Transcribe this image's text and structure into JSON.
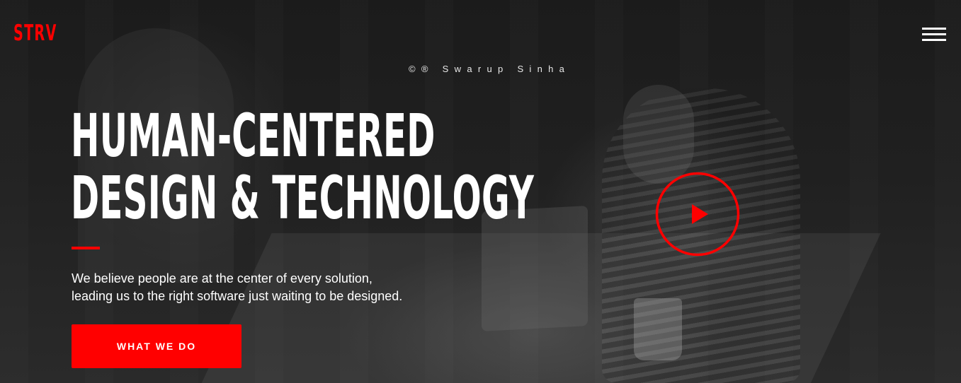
{
  "brand": {
    "logo_text": "STRV",
    "accent_color": "#ff0000"
  },
  "header": {
    "menu_icon": "hamburger-menu-icon"
  },
  "hero": {
    "credit": "©® Swarup Sinha",
    "headline_line1": "HUMAN-CENTERED",
    "headline_line2": "DESIGN & TECHNOLOGY",
    "tagline_line1": "We believe people are at the center of every solution,",
    "tagline_line2": "leading us to the right software just waiting to be designed.",
    "cta_label": "WHAT WE DO",
    "play_icon": "play-icon"
  }
}
